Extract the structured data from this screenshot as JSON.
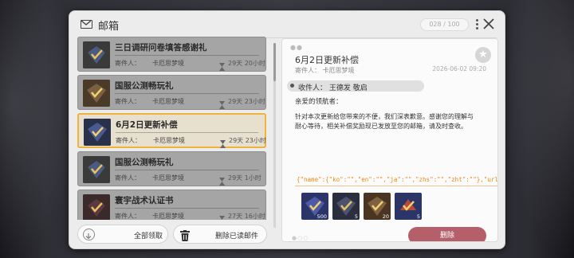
{
  "window": {
    "title": "邮箱",
    "counter": "028 / 100"
  },
  "mail_list": [
    {
      "title": "三日调研问卷填答感谢礼",
      "sender_label": "寄件人：",
      "sender": "卡厄思梦境",
      "time_left": "29天 20小时",
      "selected": false,
      "thumb": "blue"
    },
    {
      "title": "国服公测畅玩礼",
      "sender_label": "寄件人：",
      "sender": "卡厄思梦境",
      "time_left": "29天 23小时",
      "selected": false,
      "thumb": "gold"
    },
    {
      "title": "6月2日更新补偿",
      "sender_label": "寄件人：",
      "sender": "卡厄思梦境",
      "time_left": "29天 23小时",
      "selected": true,
      "thumb": "blue"
    },
    {
      "title": "国服公测畅玩礼",
      "sender_label": "寄件人：",
      "sender": "卡厄思梦境",
      "time_left": "29天 1小时",
      "selected": false,
      "thumb": "blue"
    },
    {
      "title": "寰宇战术认证书",
      "sender_label": "寄件人：",
      "sender": "卡厄思梦境",
      "time_left": "27天 16小时",
      "selected": false,
      "thumb": "red"
    }
  ],
  "buttons": {
    "claim_all": "全部领取",
    "delete_read": "删除已读邮件",
    "delete": "删除"
  },
  "detail": {
    "title": "6月2日更新补偿",
    "sender": "寄件人： 卡厄思梦境",
    "date": "2026-06-02 09:20",
    "recipient": "收件人： 王德发 敬启",
    "greeting": "亲爱的领航者：",
    "body_line1": "针对本次更新给您带来的不便，我们深表歉意。感谢您的理解与",
    "body_line2": "耐心等待，相关补偿奖励现已发放至您的邮箱，请及时查收。",
    "raw_json": "{\"name\":{\"ko\":\"\",\"en\":\"\",\"ja\":\"\",\"zhs\":\"\",\"zht\":\"\"},\"url\":{\"ko\":\"\",\"en\":\"\",\"ja\":\"\",\"zhs\":\"\",\"z",
    "rewards": [
      {
        "qty": "500",
        "style": "blue"
      },
      {
        "qty": "5",
        "style": "dark"
      },
      {
        "qty": "20",
        "style": "gold"
      },
      {
        "qty": "5",
        "style": "red"
      }
    ]
  },
  "icons": [
    "mail-icon",
    "menu-icon",
    "close-icon",
    "hourglass-icon",
    "download-icon",
    "trash-icon",
    "star-icon"
  ],
  "colors": {
    "selected_border": "#f0b33c",
    "delete_button": "#b55f6a",
    "json_text": "#e88a1a"
  }
}
